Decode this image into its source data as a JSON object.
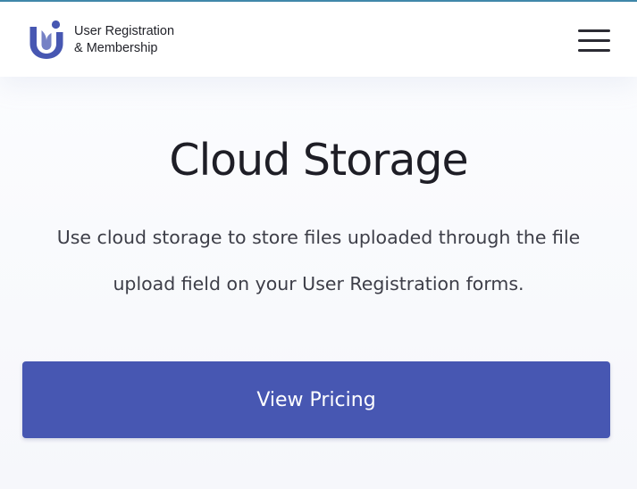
{
  "brand": {
    "line1": "User Registration",
    "line2": "& Membership",
    "logo_icon": "user-registration-logo-icon",
    "logo_color": "#4757b2"
  },
  "header": {
    "menu_icon": "hamburger-menu-icon"
  },
  "hero": {
    "title": "Cloud Storage",
    "description": "Use cloud storage to store files uploaded through the file upload field on your User Registration forms.",
    "cta_label": "View Pricing",
    "cta_color": "#4757b2"
  }
}
